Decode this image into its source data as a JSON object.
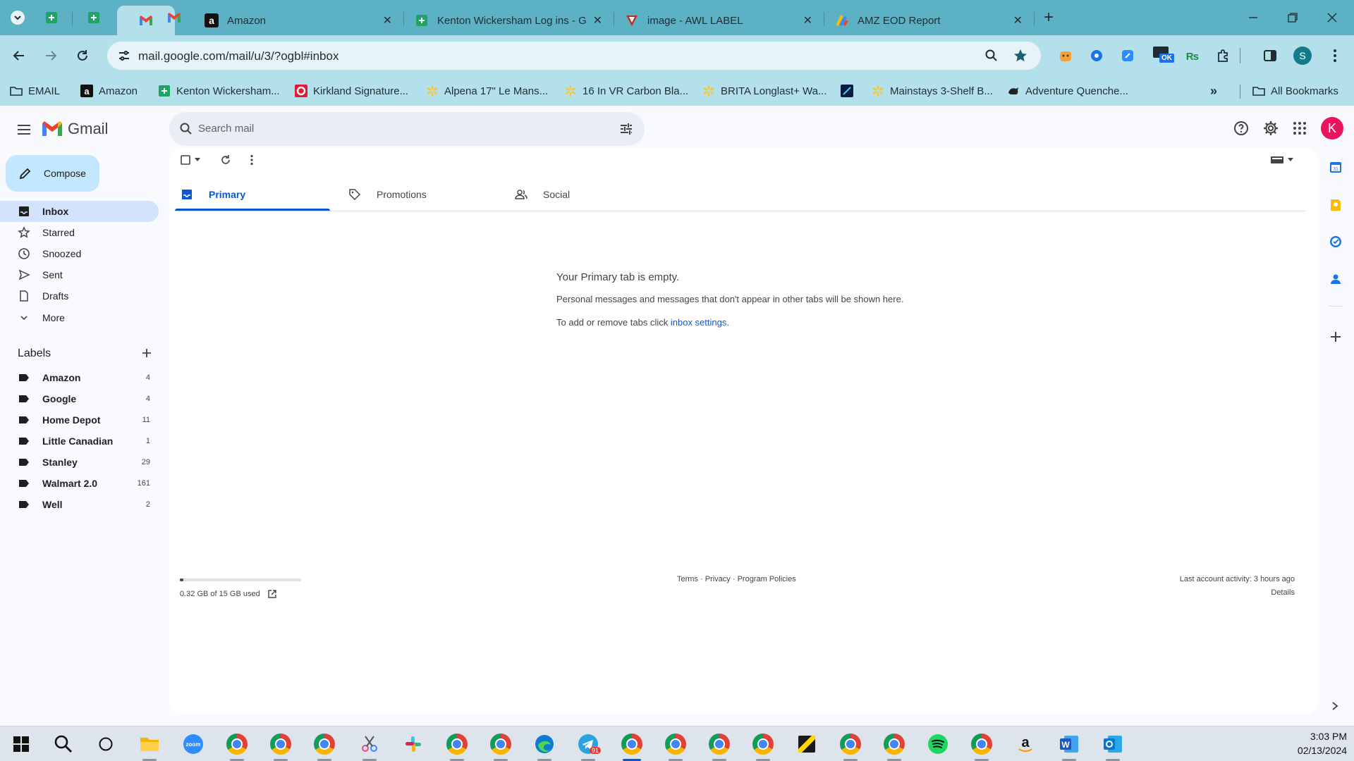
{
  "browser": {
    "tabs": [
      {
        "title": "",
        "icon": "gmail-icon",
        "pinned": true
      },
      {
        "title": "Amazon",
        "icon": "amazon-icon"
      },
      {
        "title": "Kenton Wickersham Log ins - G",
        "icon": "sheets-icon"
      },
      {
        "title": "image - AWL LABEL",
        "icon": "awl-icon"
      },
      {
        "title": "AMZ EOD Report",
        "icon": "report-icon"
      }
    ],
    "url": "mail.google.com/mail/u/3/?ogbl#inbox",
    "profile_initial": "S",
    "extension_badge": "OK",
    "bookmarks": [
      {
        "label": "EMAIL",
        "icon": "folder-icon"
      },
      {
        "label": "Amazon",
        "icon": "amazon-icon"
      },
      {
        "label": "Kenton Wickersham...",
        "icon": "sheets-icon"
      },
      {
        "label": "Kirkland Signature...",
        "icon": "costco-icon"
      },
      {
        "label": "Alpena 17\" Le Mans...",
        "icon": "walmart-icon"
      },
      {
        "label": "16 In VR Carbon Bla...",
        "icon": "walmart-icon"
      },
      {
        "label": "BRITA Longlast+ Wa...",
        "icon": "walmart-icon"
      },
      {
        "label": "",
        "icon": "dark-site-icon"
      },
      {
        "label": "Mainstays 3-Shelf B...",
        "icon": "walmart-icon"
      },
      {
        "label": "Adventure Quenche...",
        "icon": "bison-icon"
      }
    ],
    "all_bookmarks": "All Bookmarks"
  },
  "gmail": {
    "brand": "Gmail",
    "search_placeholder": "Search mail",
    "compose": "Compose",
    "account_initial": "K",
    "nav": [
      {
        "label": "Inbox",
        "icon": "inbox-icon",
        "selected": true
      },
      {
        "label": "Starred",
        "icon": "star-icon"
      },
      {
        "label": "Snoozed",
        "icon": "clock-icon"
      },
      {
        "label": "Sent",
        "icon": "send-icon"
      },
      {
        "label": "Drafts",
        "icon": "draft-icon"
      },
      {
        "label": "More",
        "icon": "chevron-down-icon"
      }
    ],
    "labels_heading": "Labels",
    "labels": [
      {
        "label": "Amazon",
        "count": "4"
      },
      {
        "label": "Google",
        "count": "4"
      },
      {
        "label": "Home Depot",
        "count": "11"
      },
      {
        "label": "Little Canadian",
        "count": "1"
      },
      {
        "label": "Stanley",
        "count": "29"
      },
      {
        "label": "Walmart 2.0",
        "count": "161"
      },
      {
        "label": "Well",
        "count": "2"
      }
    ],
    "tabs": [
      {
        "label": "Primary",
        "icon": "inbox-icon",
        "selected": true
      },
      {
        "label": "Promotions",
        "icon": "tag-icon"
      },
      {
        "label": "Social",
        "icon": "people-icon"
      }
    ],
    "empty": {
      "title": "Your Primary tab is empty.",
      "line1": "Personal messages and messages that don't appear in other tabs will be shown here.",
      "line2_prefix": "To add or remove tabs click ",
      "line2_link": "inbox settings",
      "line2_suffix": "."
    },
    "footer": {
      "storage": "0.32 GB of 15 GB used",
      "storage_fraction": 0.021,
      "terms": "Terms",
      "privacy": "Privacy",
      "policies": "Program Policies",
      "activity": "Last account activity: 3 hours ago",
      "details": "Details"
    }
  },
  "taskbar": {
    "time": "3:03 PM",
    "date": "02/13/2024",
    "badge": "91"
  },
  "colors": {
    "tabbar": "#5cb2c4",
    "toolbar": "#b3e0ea",
    "gmail_red": "#ea4335",
    "selected_nav": "#d3e3fd",
    "link": "#0b57d0",
    "avatar_k": "#e8175d"
  }
}
